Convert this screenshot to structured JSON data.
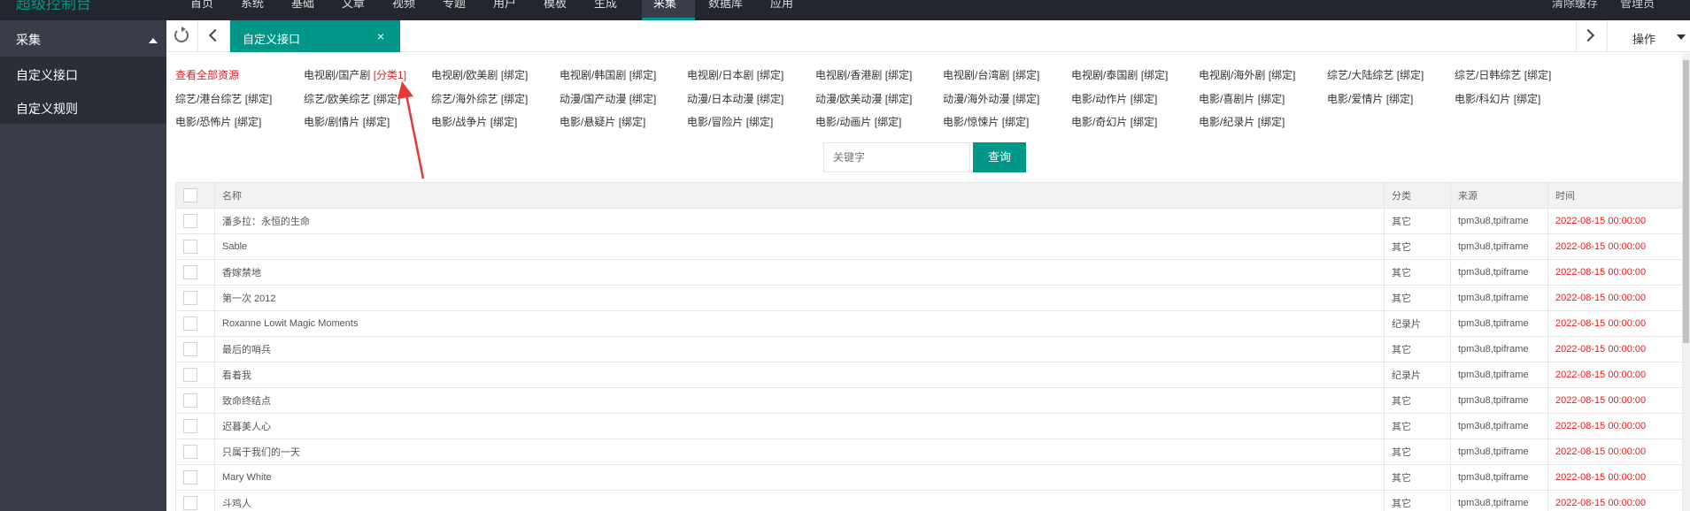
{
  "topbar": {
    "logo": "超级控制台",
    "nav": [
      "首页",
      "系统",
      "基础",
      "文章",
      "视频",
      "专题",
      "用户",
      "模板",
      "生成",
      "采集",
      "数据库",
      "应用"
    ],
    "right": [
      "清除缓存",
      "管理员"
    ]
  },
  "sidebar": {
    "section": "采集",
    "items": [
      "自定义接口",
      "自定义规则"
    ]
  },
  "tabbar": {
    "active_tab": "自定义接口",
    "close": "×",
    "operations": "操作"
  },
  "categories": {
    "view_all": "查看全部资源",
    "items": [
      {
        "name": "电视剧/国产剧",
        "tag": "[分类1]",
        "highlight": true
      },
      {
        "name": "电视剧/欧美剧",
        "tag": "[绑定]"
      },
      {
        "name": "电视剧/韩国剧",
        "tag": "[绑定]"
      },
      {
        "name": "电视剧/日本剧",
        "tag": "[绑定]"
      },
      {
        "name": "电视剧/香港剧",
        "tag": "[绑定]"
      },
      {
        "name": "电视剧/台湾剧",
        "tag": "[绑定]"
      },
      {
        "name": "电视剧/泰国剧",
        "tag": "[绑定]"
      },
      {
        "name": "电视剧/海外剧",
        "tag": "[绑定]"
      },
      {
        "name": "综艺/大陆综艺",
        "tag": "[绑定]"
      },
      {
        "name": "综艺/日韩综艺",
        "tag": "[绑定]"
      },
      {
        "name": "综艺/港台综艺",
        "tag": "[绑定]"
      },
      {
        "name": "综艺/欧美综艺",
        "tag": "[绑定]"
      },
      {
        "name": "综艺/海外综艺",
        "tag": "[绑定]"
      },
      {
        "name": "动漫/国产动漫",
        "tag": "[绑定]"
      },
      {
        "name": "动漫/日本动漫",
        "tag": "[绑定]"
      },
      {
        "name": "动漫/欧美动漫",
        "tag": "[绑定]"
      },
      {
        "name": "动漫/海外动漫",
        "tag": "[绑定]"
      },
      {
        "name": "电影/动作片",
        "tag": "[绑定]"
      },
      {
        "name": "电影/喜剧片",
        "tag": "[绑定]"
      },
      {
        "name": "电影/爱情片",
        "tag": "[绑定]"
      },
      {
        "name": "电影/科幻片",
        "tag": "[绑定]"
      },
      {
        "name": "电影/恐怖片",
        "tag": "[绑定]"
      },
      {
        "name": "电影/剧情片",
        "tag": "[绑定]"
      },
      {
        "name": "电影/战争片",
        "tag": "[绑定]"
      },
      {
        "name": "电影/悬疑片",
        "tag": "[绑定]"
      },
      {
        "name": "电影/冒险片",
        "tag": "[绑定]"
      },
      {
        "name": "电影/动画片",
        "tag": "[绑定]"
      },
      {
        "name": "电影/惊悚片",
        "tag": "[绑定]"
      },
      {
        "name": "电影/奇幻片",
        "tag": "[绑定]"
      },
      {
        "name": "电影/纪录片",
        "tag": "[绑定]"
      }
    ]
  },
  "search": {
    "placeholder": "关键字",
    "button": "查询"
  },
  "table": {
    "headers": [
      "",
      "名称",
      "分类",
      "来源",
      "时间"
    ],
    "rows": [
      {
        "name": "潘多拉：永恒的生命",
        "category": "其它",
        "source": "tpm3u8,tpiframe",
        "time": "2022-08-15 00:00:00"
      },
      {
        "name": "Sable",
        "category": "其它",
        "source": "tpm3u8,tpiframe",
        "time": "2022-08-15 00:00:00"
      },
      {
        "name": "香嫁禁地",
        "category": "其它",
        "source": "tpm3u8,tpiframe",
        "time": "2022-08-15 00:00:00"
      },
      {
        "name": "第一次 2012",
        "category": "其它",
        "source": "tpm3u8,tpiframe",
        "time": "2022-08-15 00:00:00"
      },
      {
        "name": "Roxanne Lowit Magic Moments",
        "category": "纪录片",
        "source": "tpm3u8,tpiframe",
        "time": "2022-08-15 00:00:00"
      },
      {
        "name": "最后的哨兵",
        "category": "其它",
        "source": "tpm3u8,tpiframe",
        "time": "2022-08-15 00:00:00"
      },
      {
        "name": "看着我",
        "category": "纪录片",
        "source": "tpm3u8,tpiframe",
        "time": "2022-08-15 00:00:00"
      },
      {
        "name": "致命终结点",
        "category": "其它",
        "source": "tpm3u8,tpiframe",
        "time": "2022-08-15 00:00:00"
      },
      {
        "name": "迟暮美人心",
        "category": "其它",
        "source": "tpm3u8,tpiframe",
        "time": "2022-08-15 00:00:00"
      },
      {
        "name": "只属于我们的一天",
        "category": "其它",
        "source": "tpm3u8,tpiframe",
        "time": "2022-08-15 00:00:00"
      },
      {
        "name": "Mary White",
        "category": "其它",
        "source": "tpm3u8,tpiframe",
        "time": "2022-08-15 00:00:00"
      },
      {
        "name": "斗鸡人",
        "category": "其它",
        "source": "tpm3u8,tpiframe",
        "time": "2022-08-15 00:00:00"
      }
    ]
  }
}
